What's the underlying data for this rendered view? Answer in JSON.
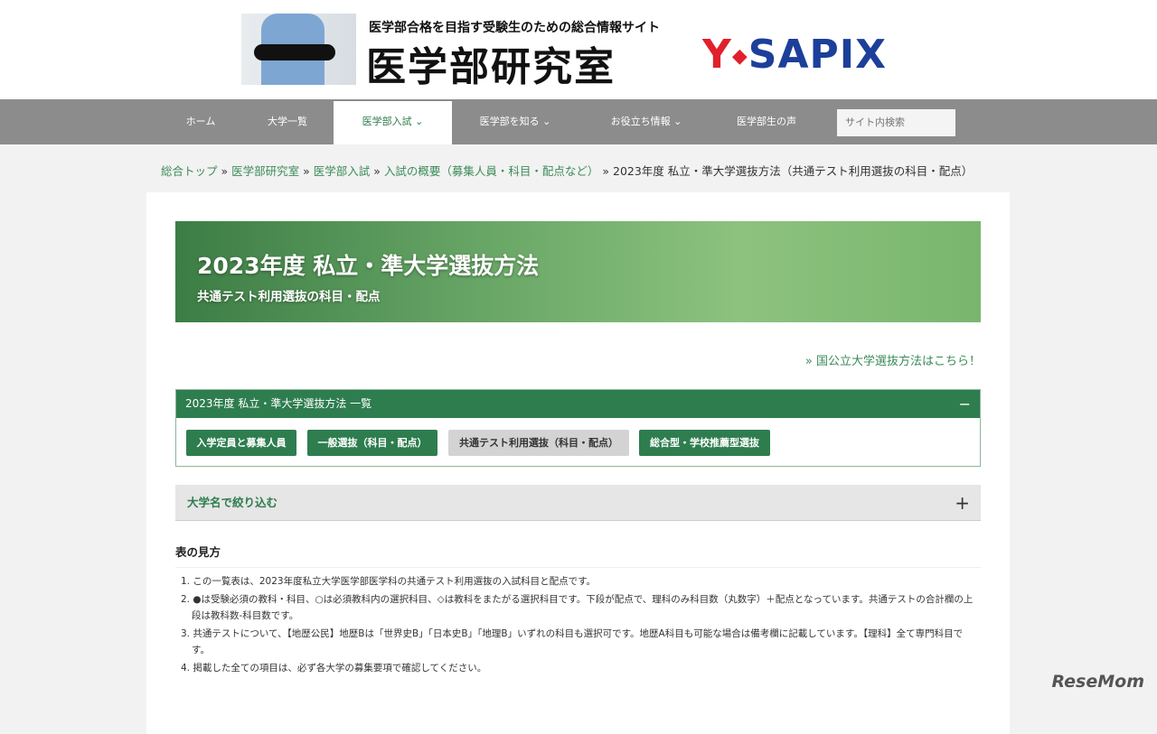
{
  "header": {
    "tagline": "医学部合格を目指す受験生のための総合情報サイト",
    "site_name": "医学部研究室",
    "partner_logo": "Y·SAPIX"
  },
  "nav": {
    "items": [
      "ホーム",
      "大学一覧",
      "医学部入試 ⌄",
      "医学部を知る ⌄",
      "お役立ち情報 ⌄",
      "医学部生の声"
    ],
    "search_placeholder": "サイト内検索"
  },
  "breadcrumb": {
    "items": [
      "総合トップ",
      "医学部研究室",
      "医学部入試",
      "入試の概要（募集人員・科目・配点など）"
    ],
    "sep": " » ",
    "current": "2023年度 私立・準大学選抜方法（共通テスト利用選抜の科目・配点）"
  },
  "banner": {
    "title": "2023年度 私立・準大学選抜方法",
    "subtitle": "共通テスト利用選抜の科目・配点"
  },
  "link_national": "» 国公立大学選抜方法はこちら！",
  "accordion": {
    "title": "2023年度 私立・準大学選抜方法 一覧",
    "toggle": "−",
    "buttons": [
      "入学定員と募集人員",
      "一般選抜（科目・配点）",
      "共通テスト利用選抜（科目・配点）",
      "総合型・学校推薦型選抜"
    ]
  },
  "filter": {
    "label": "大学名で絞り込む",
    "toggle": "+"
  },
  "howto": {
    "title": "表の見方",
    "items": [
      "1. この一覧表は、2023年度私立大学医学部医学科の共通テスト利用選抜の入試科目と配点です。",
      "2. ●は受験必須の教科・科目、○は必須教科内の選択科目、◇は教科をまたがる選択科目です。下段が配点で、理科のみ科目数（丸数字）＋配点となっています。共通テストの合計欄の上段は教科数-科目数です。",
      "3. 共通テストについて、【地歴公民】地歴Bは「世界史B」「日本史B」「地理B」いずれの科目も選択可です。地歴A科目も可能な場合は備考欄に記載しています。【理科】全て専門科目です。",
      "4. 掲載した全ての項目は、必ず各大学の募集要項で確認してください。"
    ]
  },
  "watermark": "ReseMom"
}
